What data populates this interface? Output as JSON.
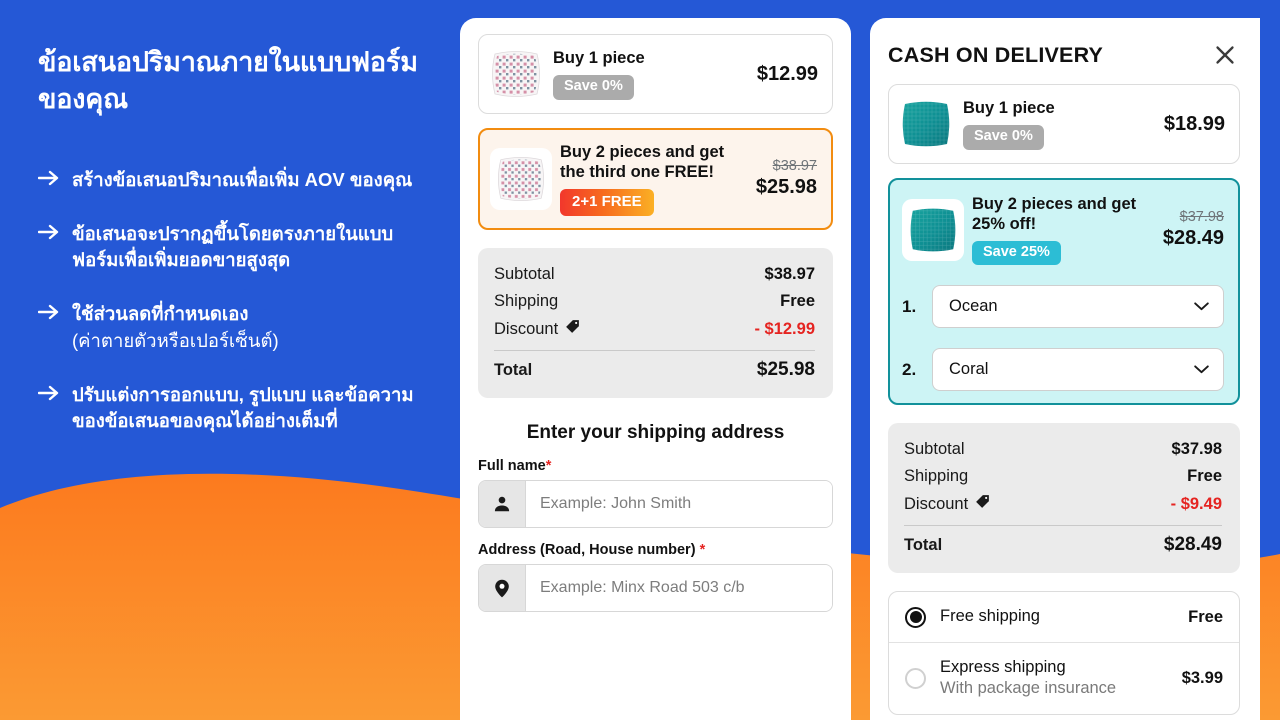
{
  "promo": {
    "title": "ข้อเสนอปริมาณภายในแบบฟอร์มของคุณ",
    "bullets": [
      {
        "text": "สร้างข้อเสนอปริมาณเพื่อเพิ่ม AOV ของคุณ",
        "sub": ""
      },
      {
        "text": "ข้อเสนอจะปรากฏขึ้นโดยตรงภายในแบบฟอร์มเพื่อเพิ่มยอดขายสูงสุด",
        "sub": ""
      },
      {
        "text": "ใช้ส่วนลดที่กำหนดเอง",
        "sub": "(ค่าตายตัวหรือเปอร์เซ็นต์)"
      },
      {
        "text": "ปรับแต่งการออกแบบ, รูปแบบ และข้อความของข้อเสนอของคุณได้อย่างเต็มที่",
        "sub": ""
      }
    ],
    "arrow_icon": "arrow-right-icon"
  },
  "colors": {
    "brand_blue": "#2558D6",
    "brand_orange": "#FB8A23",
    "accent_orange": "#F28C10",
    "accent_teal": "#12919B",
    "discount_red": "#E52421"
  },
  "middle": {
    "offers": [
      {
        "title": "Buy 1 piece",
        "badge": "Save 0%",
        "badge_style": "grey",
        "old_price": "",
        "price": "$12.99",
        "selected": false,
        "thumb": "pillow-dots-thumbnail"
      },
      {
        "title": "Buy 2 pieces and get the third one FREE!",
        "badge": "2+1 FREE",
        "badge_style": "flame",
        "old_price": "$38.97",
        "price": "$25.98",
        "selected": true,
        "thumb": "pillow-dots-thumbnail"
      }
    ],
    "summary": {
      "subtotal_label": "Subtotal",
      "subtotal_value": "$38.97",
      "shipping_label": "Shipping",
      "shipping_value": "Free",
      "discount_label": "Discount",
      "discount_value": "- $12.99",
      "total_label": "Total",
      "total_value": "$25.98",
      "discount_icon": "price-tag-icon"
    },
    "form": {
      "heading": "Enter your shipping address",
      "fields": [
        {
          "label": "Full name",
          "required": "*",
          "placeholder": "Example: John Smith",
          "value": "",
          "icon": "person-icon"
        },
        {
          "label": "Address (Road, House number)",
          "required": "*",
          "placeholder": "Example: Minx Road 503 c/b",
          "value": "",
          "icon": "map-pin-icon"
        }
      ]
    }
  },
  "right": {
    "header_title": "CASH ON DELIVERY",
    "close_icon": "close-icon",
    "offers": [
      {
        "title": "Buy 1 piece",
        "badge": "Save 0%",
        "badge_style": "grey",
        "old_price": "",
        "price": "$18.99",
        "selected": false,
        "thumb": "pillow-teal-thumbnail"
      },
      {
        "title": "Buy 2 pieces and get 25% off!",
        "badge": "Save 25%",
        "badge_style": "teal",
        "old_price": "$37.98",
        "price": "$28.49",
        "selected": true,
        "thumb": "pillow-teal-thumbnail"
      }
    ],
    "variants": [
      {
        "number": "1.",
        "value": "Ocean",
        "chevron": "chevron-down-icon"
      },
      {
        "number": "2.",
        "value": "Coral",
        "chevron": "chevron-down-icon"
      }
    ],
    "summary": {
      "subtotal_label": "Subtotal",
      "subtotal_value": "$37.98",
      "shipping_label": "Shipping",
      "shipping_value": "Free",
      "discount_label": "Discount",
      "discount_value": "- $9.49",
      "total_label": "Total",
      "total_value": "$28.49",
      "discount_icon": "price-tag-icon"
    },
    "shipping_options": [
      {
        "name": "Free shipping",
        "sub": "",
        "price": "Free",
        "selected": true
      },
      {
        "name": "Express shipping",
        "sub": "With package insurance",
        "price": "$3.99",
        "selected": false
      }
    ]
  }
}
